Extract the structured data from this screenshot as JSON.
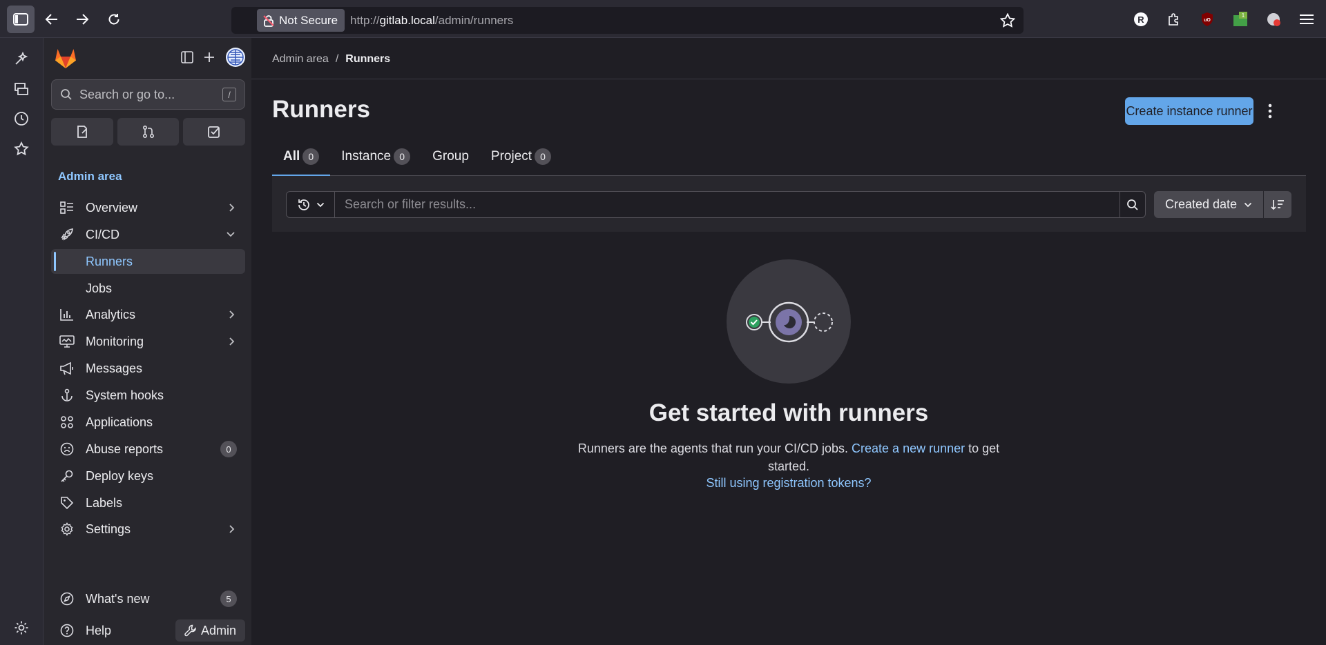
{
  "browser": {
    "security_label": "Not Secure",
    "url_prefix": "http://",
    "url_host": "gitlab.local",
    "url_path": "/admin/runners"
  },
  "sidebar": {
    "search_placeholder": "Search or go to...",
    "search_shortcut": "/",
    "section_title": "Admin area",
    "items": [
      {
        "label": "Overview",
        "icon": "overview-icon",
        "chevron": "right"
      },
      {
        "label": "CI/CD",
        "icon": "rocket-icon",
        "chevron": "down"
      },
      {
        "label": "Runners",
        "active": true
      },
      {
        "label": "Jobs"
      },
      {
        "label": "Analytics",
        "icon": "chart-icon",
        "chevron": "right"
      },
      {
        "label": "Monitoring",
        "icon": "monitor-icon",
        "chevron": "right"
      },
      {
        "label": "Messages",
        "icon": "megaphone-icon"
      },
      {
        "label": "System hooks",
        "icon": "hook-icon"
      },
      {
        "label": "Applications",
        "icon": "apps-icon"
      },
      {
        "label": "Abuse reports",
        "icon": "abuse-icon",
        "count": "0"
      },
      {
        "label": "Deploy keys",
        "icon": "key-icon"
      },
      {
        "label": "Labels",
        "icon": "label-icon"
      },
      {
        "label": "Settings",
        "icon": "gear-icon",
        "chevron": "right"
      }
    ],
    "whats_new": {
      "label": "What's new",
      "count": "5"
    },
    "help": {
      "label": "Help"
    },
    "admin_button": "Admin"
  },
  "main": {
    "breadcrumb": {
      "parent": "Admin area",
      "separator": "/",
      "current": "Runners"
    },
    "title": "Runners",
    "create_button": "Create instance runner",
    "tabs": [
      {
        "label": "All",
        "count": "0",
        "active": true
      },
      {
        "label": "Instance",
        "count": "0"
      },
      {
        "label": "Group",
        "count": null
      },
      {
        "label": "Project",
        "count": "0"
      }
    ],
    "filter": {
      "placeholder": "Search or filter results...",
      "sort_label": "Created date"
    },
    "empty_state": {
      "title": "Get started with runners",
      "text_before": "Runners are the agents that run your CI/CD jobs. ",
      "link_text": "Create a new runner",
      "text_after": " to get started.",
      "secondary_link": "Still using registration tokens?"
    }
  },
  "colors": {
    "accent": "#63a6e9",
    "link": "#8fc7ff",
    "background": "#1f1e24",
    "sidebar": "#28272d"
  }
}
